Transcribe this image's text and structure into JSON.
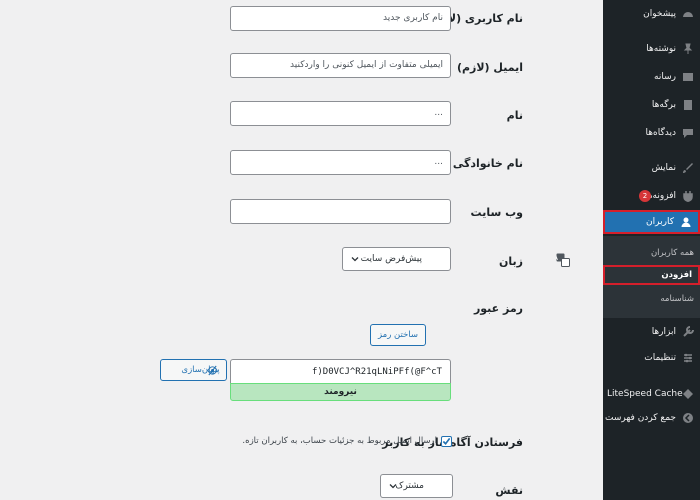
{
  "sidebar": {
    "items": [
      {
        "label": "پیشخوان",
        "icon": "dashboard-icon"
      },
      {
        "label": "نوشته‌ها",
        "icon": "pin-icon"
      },
      {
        "label": "رسانه",
        "icon": "media-icon"
      },
      {
        "label": "برگه‌ها",
        "icon": "page-icon"
      },
      {
        "label": "دیدگاه‌ها",
        "icon": "comment-icon"
      },
      {
        "label": "نمایش",
        "icon": "brush-icon"
      },
      {
        "label": "افزونه‌ها",
        "icon": "plugin-icon",
        "badge": "2"
      },
      {
        "label": "کاربران",
        "icon": "users-icon",
        "active": true
      },
      {
        "label": "ابزارها",
        "icon": "tools-icon"
      },
      {
        "label": "تنظیمات",
        "icon": "settings-icon"
      },
      {
        "label": "LiteSpeed Cache",
        "icon": "litespeed-icon"
      },
      {
        "label": "جمع کردن فهرست",
        "icon": "collapse-icon"
      }
    ],
    "submenu": [
      "همه کاربران",
      "افزودن",
      "شناسنامه"
    ]
  },
  "form": {
    "username": {
      "label": "نام کاربری (لازم)",
      "placeholder": "نام کاربری جدید"
    },
    "email": {
      "label": "ایمیل (لازم)",
      "placeholder": "ایمیلی متفاوت از ایمیل کنونی را واردکنید"
    },
    "first_name": {
      "label": "نام",
      "value": "..."
    },
    "last_name": {
      "label": "نام خانوادگی",
      "value": "..."
    },
    "website": {
      "label": "وب سایت",
      "value": ""
    },
    "language": {
      "label": "زبان",
      "selected": "پیش‌فرض سایت"
    },
    "password": {
      "label": "رمز عبور",
      "generate_button": "ساختن رمز",
      "value": "f)D0VCJ^R21qLNiPFf(@F^cT",
      "hide_button": "پنهان‌سازی",
      "strength": "نیرومند"
    },
    "notify": {
      "label": "فرستادن آگاه‌ساز به کاربر",
      "text": "ارسال ایمیل مربوط به جزئیات حساب، به کاربران تازه.",
      "checked": true
    },
    "role": {
      "label": "نقش",
      "selected": "مشترک"
    }
  },
  "colors": {
    "sidebar_bg": "#1d2327",
    "accent": "#2271b1",
    "highlight_border": "#d51f2b",
    "strength_bg": "#b8e6bf",
    "page_bg": "#f0f0f1"
  }
}
